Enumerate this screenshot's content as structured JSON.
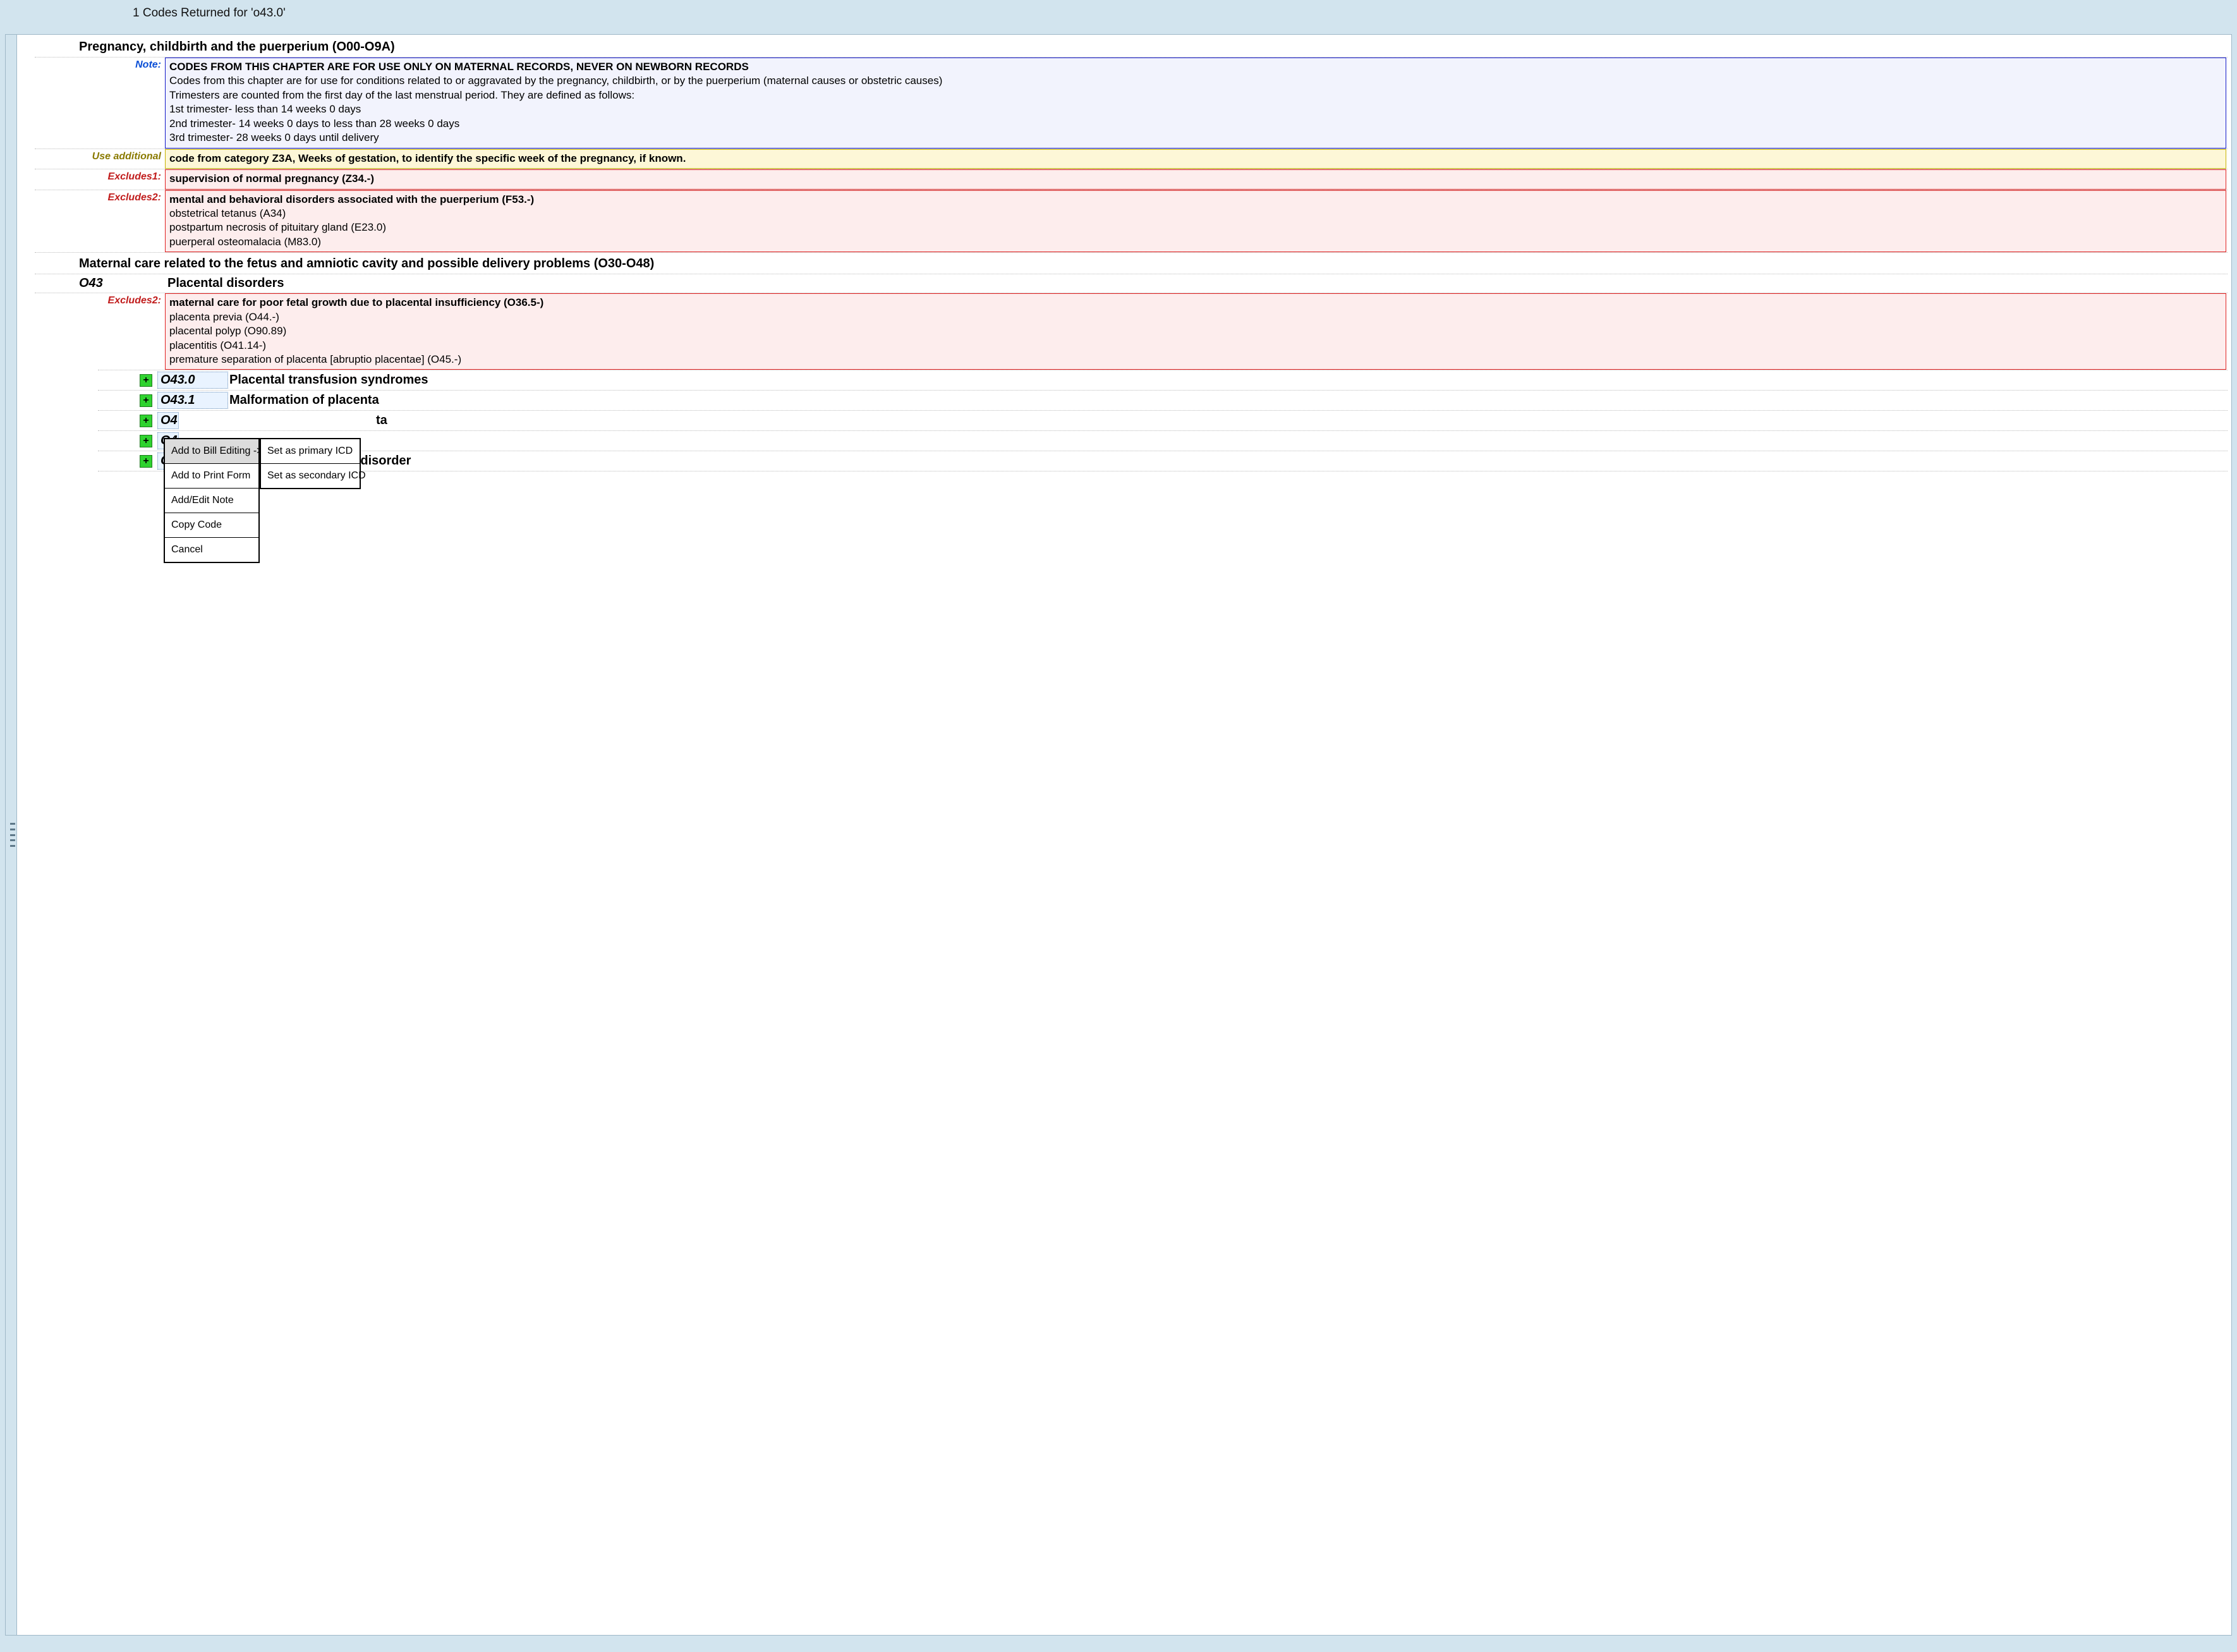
{
  "top_bar": "1 Codes Returned for 'o43.0'",
  "chapter_title": "Pregnancy, childbirth and the puerperium (O00-O9A)",
  "note_label": "Note:",
  "note_bold": "CODES FROM THIS CHAPTER ARE FOR USE ONLY ON MATERNAL RECORDS, NEVER ON NEWBORN RECORDS",
  "note_line1": "Codes from this chapter are for use for conditions related to or aggravated by the pregnancy, childbirth, or by the puerperium (maternal causes or obstetric causes)",
  "note_line2": "Trimesters are counted from the first day of the last menstrual period. They are defined as follows:",
  "note_line3": "1st trimester- less than 14 weeks 0 days",
  "note_line4": "2nd trimester- 14 weeks 0 days to less than 28 weeks 0 days",
  "note_line5": "3rd trimester- 28 weeks 0 days until delivery",
  "useadd_label": "Use additional",
  "useadd_text": "code from category Z3A, Weeks of gestation, to identify the specific week of the pregnancy, if known.",
  "excl1_label": "Excludes1:",
  "excl1_text": "supervision of normal pregnancy (Z34.-)",
  "excl2a_label": "Excludes2:",
  "excl2a_bold": "mental and behavioral disorders associated with the puerperium (F53.-)",
  "excl2a_l1": "obstetrical tetanus (A34)",
  "excl2a_l2": "postpartum necrosis of pituitary gland (E23.0)",
  "excl2a_l3": "puerperal osteomalacia (M83.0)",
  "section_title": "Maternal care related to the fetus and amniotic cavity and possible delivery problems (O30-O48)",
  "o43_code": "O43",
  "o43_label": "Placental disorders",
  "excl2b_label": "Excludes2:",
  "excl2b_bold": "maternal care for poor fetal growth due to placental insufficiency (O36.5-)",
  "excl2b_l1": "placenta previa (O44.-)",
  "excl2b_l2": "placental polyp (O90.89)",
  "excl2b_l3": "placentitis (O41.14-)",
  "excl2b_l4": "premature separation of placenta [abruptio placentae] (O45.-)",
  "sub": {
    "0": {
      "code": "O43.0",
      "label": "Placental transfusion syndromes"
    },
    "1": {
      "code": "O43.1",
      "label": "Malformation of placenta"
    },
    "2": {
      "code": "O4",
      "label_tail": "ta"
    },
    "3": {
      "code": "O4",
      "label": ""
    },
    "4": {
      "code": "O4",
      "label_tail": "fied placental disorder"
    }
  },
  "ctx": {
    "i0": "Add to Bill Editing ->",
    "i1": "Add to Print Form",
    "i2": "Add/Edit Note",
    "i3": "Copy Code",
    "i4": "Cancel",
    "s0": "Set as primary ICD",
    "s1": "Set as secondary ICD"
  }
}
